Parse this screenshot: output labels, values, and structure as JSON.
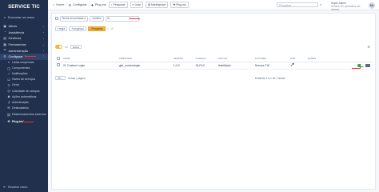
{
  "brand": "SERVICE TIC",
  "sidebar": {
    "search_label": "Encontrar um menu",
    "items": [
      {
        "label": "Ativos",
        "icon": "box-icon"
      },
      {
        "label": "Assistência",
        "icon": "headset-icon"
      },
      {
        "label": "Gerência",
        "icon": "wallet-icon"
      },
      {
        "label": "Ferramentas",
        "icon": "briefcase-icon"
      },
      {
        "label": "Administração",
        "icon": "shield-icon"
      },
      {
        "label": "Configurar",
        "icon": "gear-icon"
      }
    ],
    "subitems": [
      {
        "label": "Listas suspensas"
      },
      {
        "label": "Componentes"
      },
      {
        "label": "Notificações"
      },
      {
        "label": "Níveis de serviços"
      },
      {
        "label": "Geral"
      },
      {
        "label": "Unicidade de campos"
      },
      {
        "label": "Ações automáticas"
      },
      {
        "label": "Autenticação"
      },
      {
        "label": "Destinatários"
      },
      {
        "label": "Relacionamentos externos"
      },
      {
        "label": "Plug-ins"
      }
    ],
    "collapse_label": "Recolher menu"
  },
  "topbar": {
    "crumbs": [
      "Home",
      "Configurar",
      "Plug-ins"
    ],
    "buttons": [
      "Pesquisar",
      "Lista",
      "Marketplace",
      "Plug-ins"
    ],
    "search_placeholder": "Pesquisar",
    "user_name": "Super-Admin",
    "user_entity": "Service TIC (estrutura em árvore)",
    "avatar_initials": "SA"
  },
  "filter": {
    "field": "Nome encontrado e",
    "operator": "contém",
    "value": "ik"
  },
  "actions": {
    "rule": "regra",
    "group": "um grupo",
    "search": "Pesquisar"
  },
  "toolbar": {
    "ops": "Ações"
  },
  "table": {
    "headers": [
      "NOME",
      "DIRETÓRIO",
      "VERSÃO",
      "LICENÇA",
      "STATUS",
      "AUTORES",
      "SITE",
      "AÇÕES"
    ],
    "rows": [
      {
        "name": "JC Custom Login",
        "directory": "glpi_customlogin",
        "version": "1.0.0",
        "license": "GLPv3",
        "status": "Habilitado",
        "authors": "Service TIC"
      }
    ]
  },
  "pagination": {
    "per_page": "20",
    "per_page_label": "linhas / página",
    "showing": "Exibindo 1 a 1 de 1 linhas"
  },
  "colors": {
    "sidebar": "#21304d",
    "accent": "#f2b73d",
    "enabled": "#3aa14b",
    "marker": "#e53935"
  }
}
